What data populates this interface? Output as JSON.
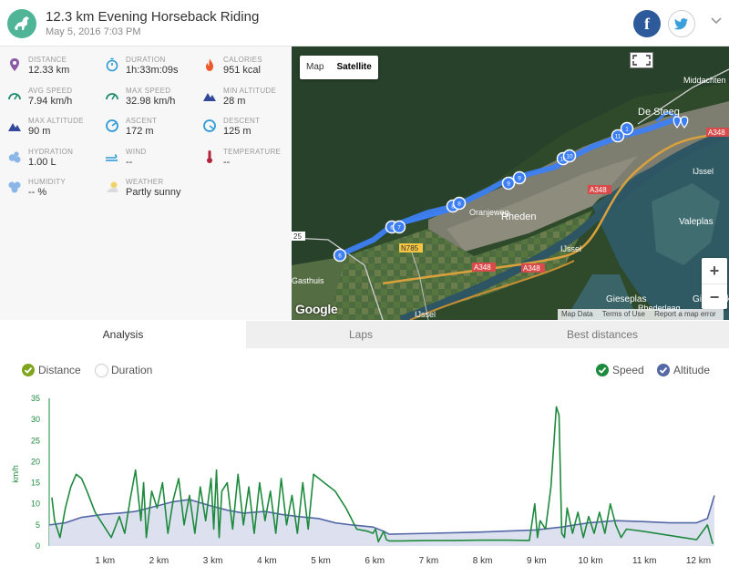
{
  "header": {
    "title": "12.3 km Evening Horseback Riding",
    "subtitle": "May 5, 2016 7:03 PM"
  },
  "stats": [
    {
      "label": "DISTANCE",
      "value": "12.33 km",
      "icon": "location-pin-icon"
    },
    {
      "label": "DURATION",
      "value": "1h:33m:09s",
      "icon": "stopwatch-icon"
    },
    {
      "label": "CALORIES",
      "value": "951 kcal",
      "icon": "flame-icon"
    },
    {
      "label": "AVG SPEED",
      "value": "7.94 km/h",
      "icon": "speedometer-icon"
    },
    {
      "label": "MAX SPEED",
      "value": "32.98 km/h",
      "icon": "speedometer-icon"
    },
    {
      "label": "MIN ALTITUDE",
      "value": "28 m",
      "icon": "mountain-icon"
    },
    {
      "label": "MAX ALTITUDE",
      "value": "90 m",
      "icon": "mountain-icon"
    },
    {
      "label": "ASCENT",
      "value": "172 m",
      "icon": "ascent-icon"
    },
    {
      "label": "DESCENT",
      "value": "125 m",
      "icon": "descent-icon"
    },
    {
      "label": "HYDRATION",
      "value": "1.00 L",
      "icon": "water-drops-icon"
    },
    {
      "label": "WIND",
      "value": "--",
      "icon": "wind-icon"
    },
    {
      "label": "TEMPERATURE",
      "value": "--",
      "icon": "thermometer-icon"
    },
    {
      "label": "HUMIDITY",
      "value": "-- %",
      "icon": "humidity-icon"
    },
    {
      "label": "WEATHER",
      "value": "Partly sunny",
      "icon": "partly-sunny-icon"
    }
  ],
  "map": {
    "type_map": "Map",
    "type_satellite": "Satellite",
    "place_labels": [
      "De Steeg",
      "Rheden",
      "Oranjeweg",
      "Valeplas",
      "Gieseplas",
      "IJssel",
      "IJssel",
      "IJssel",
      "Middachten",
      "Giesbeek",
      "Gasthuis",
      "Rhederlaag"
    ],
    "road_labels": [
      "A348",
      "A348",
      "A348",
      "A348",
      "N785",
      "25"
    ],
    "markers": [
      "6",
      "6",
      "7",
      "8",
      "8",
      "9",
      "9",
      "10",
      "10",
      "11",
      "1"
    ],
    "attribution": {
      "data": "Map Data",
      "terms": "Terms of Use",
      "report": "Report a map error"
    },
    "logo": "Google"
  },
  "tabs": [
    {
      "label": "Analysis",
      "active": true
    },
    {
      "label": "Laps",
      "active": false
    },
    {
      "label": "Best distances",
      "active": false
    }
  ],
  "legend": {
    "distance": "Distance",
    "duration": "Duration",
    "speed": "Speed",
    "altitude": "Altitude"
  },
  "colors": {
    "accent": "#4fb596",
    "speed": "#1e8a3e",
    "altitude": "#5468a8",
    "altitude_fill": "#d9deed",
    "route": "#3d7ff2",
    "check_green": "#7fa51d"
  },
  "chart_data": {
    "type": "line",
    "ylabel": "km/h",
    "ylim": [
      0,
      35
    ],
    "yticks": [
      0,
      5,
      10,
      15,
      20,
      25,
      30,
      35
    ],
    "xlim": [
      0,
      12.33
    ],
    "xticks": [
      "1 km",
      "2 km",
      "3 km",
      "4 km",
      "5 km",
      "6 km",
      "7 km",
      "8 km",
      "9 km",
      "10 km",
      "11 km",
      "12 km"
    ],
    "series": [
      {
        "name": "Speed",
        "x": [
          0.05,
          0.1,
          0.2,
          0.3,
          0.4,
          0.5,
          0.6,
          0.7,
          0.85,
          1.0,
          1.15,
          1.3,
          1.4,
          1.5,
          1.6,
          1.7,
          1.75,
          1.8,
          1.9,
          2.0,
          2.1,
          2.2,
          2.3,
          2.4,
          2.5,
          2.6,
          2.7,
          2.8,
          2.9,
          3.0,
          3.05,
          3.1,
          3.15,
          3.2,
          3.3,
          3.4,
          3.5,
          3.6,
          3.7,
          3.8,
          3.9,
          4.0,
          4.1,
          4.2,
          4.3,
          4.4,
          4.5,
          4.6,
          4.7,
          4.8,
          4.9,
          5.0,
          5.1,
          5.2,
          5.3,
          5.5,
          5.7,
          5.9,
          6.0,
          6.05,
          6.1,
          6.2,
          6.25,
          6.3,
          6.5,
          7.0,
          7.5,
          8.0,
          8.5,
          8.9,
          9.0,
          9.05,
          9.1,
          9.2,
          9.3,
          9.4,
          9.45,
          9.5,
          9.55,
          9.6,
          9.7,
          9.8,
          9.9,
          10.0,
          10.1,
          10.2,
          10.3,
          10.4,
          10.5,
          10.6,
          10.7,
          11.0,
          11.5,
          12.0,
          12.2,
          12.3
        ],
        "y": [
          11.5,
          6,
          2,
          9,
          14,
          17,
          16,
          13,
          8,
          5,
          2,
          7,
          3,
          11,
          18,
          6,
          15,
          2,
          13,
          9,
          15,
          3,
          11,
          16,
          5,
          12,
          3,
          14,
          6,
          16,
          4,
          18,
          2,
          13,
          15,
          4,
          17,
          5,
          14,
          3,
          15,
          6,
          13,
          3,
          16,
          5,
          12,
          3,
          15,
          4,
          17,
          16,
          15,
          14,
          13,
          9,
          4,
          3.5,
          3,
          4,
          1,
          3.5,
          1.5,
          1.2,
          1.2,
          1.3,
          1.3,
          1.4,
          1.4,
          1.3,
          10,
          2,
          6,
          4,
          14,
          33,
          31,
          3,
          2,
          9,
          3,
          8,
          2,
          7,
          3,
          8,
          3,
          10,
          5,
          2,
          4,
          3.5,
          2.5,
          1.5,
          5,
          0.5
        ]
      },
      {
        "name": "Altitude",
        "x": [
          0.0,
          0.3,
          0.6,
          1.0,
          1.3,
          1.6,
          2.0,
          2.3,
          2.6,
          3.0,
          3.3,
          3.6,
          4.0,
          4.3,
          4.6,
          5.0,
          5.3,
          5.6,
          6.0,
          6.2,
          6.3,
          7.0,
          8.0,
          9.0,
          9.5,
          10.0,
          10.5,
          11.0,
          11.5,
          12.0,
          12.2,
          12.33
        ],
        "y": [
          5,
          5.5,
          6.8,
          7.5,
          7.8,
          8.2,
          9.5,
          10.5,
          11,
          9.5,
          8.5,
          7.8,
          8.2,
          7.5,
          7,
          6.5,
          5.5,
          5,
          4.5,
          3.5,
          2.8,
          3,
          3.3,
          3.8,
          4.5,
          5.5,
          6,
          5.8,
          5.5,
          5.5,
          6.5,
          12
        ]
      }
    ]
  }
}
